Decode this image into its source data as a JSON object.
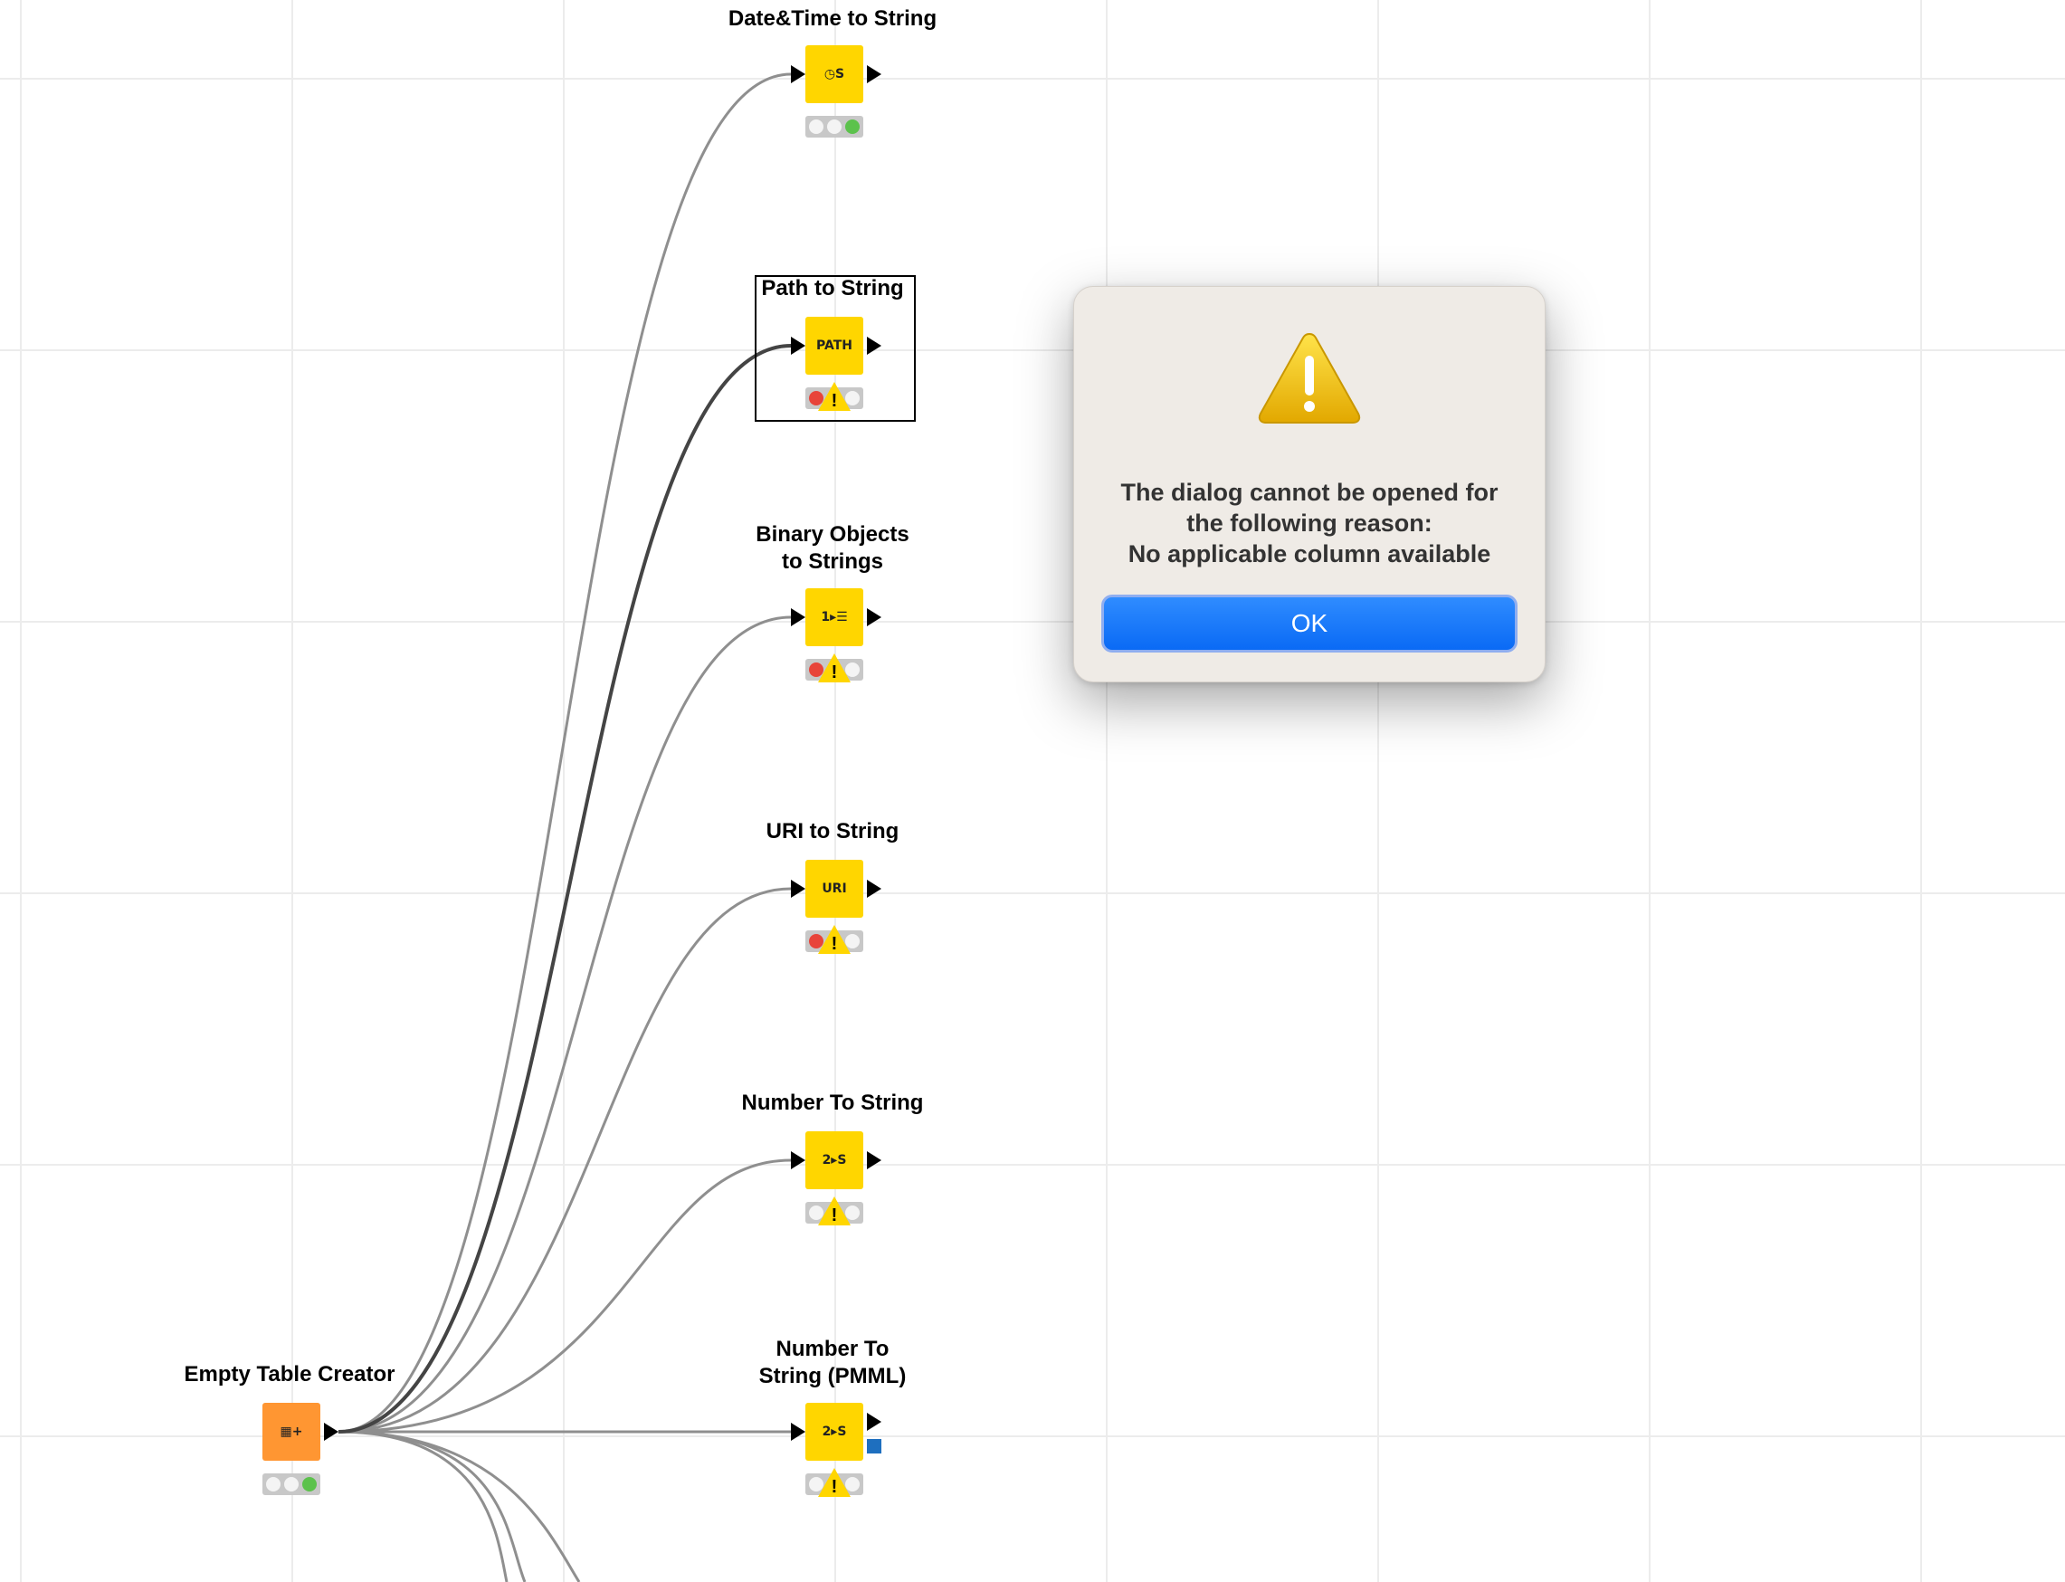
{
  "workflow": {
    "nodes": [
      {
        "id": "date_time_to_string",
        "label": "Date&Time to String",
        "icon": "clock-to-string-icon",
        "glyph": "◷S",
        "color": "yellow",
        "status": [
          "off",
          "off",
          "green"
        ],
        "warning": false
      },
      {
        "id": "path_to_string",
        "label": "Path to String",
        "icon": "path-to-string-icon",
        "glyph": "PATH",
        "color": "yellow",
        "status": [
          "red",
          "off",
          "off"
        ],
        "warning": true,
        "selected": true
      },
      {
        "id": "binary_objects_to_strings",
        "label_line1": "Binary Objects",
        "label_line2": "to Strings",
        "icon": "binary-to-string-icon",
        "glyph": "1▸☰",
        "color": "yellow",
        "status": [
          "red",
          "off",
          "off"
        ],
        "warning": true
      },
      {
        "id": "uri_to_string",
        "label": "URI to String",
        "icon": "uri-to-string-icon",
        "glyph": "URI",
        "color": "yellow",
        "status": [
          "red",
          "off",
          "off"
        ],
        "warning": true
      },
      {
        "id": "number_to_string",
        "label": "Number To String",
        "icon": "number-to-string-icon",
        "glyph": "2▸S",
        "color": "yellow",
        "status": [
          "off",
          "off",
          "off"
        ],
        "warning": true
      },
      {
        "id": "number_to_string_pmml",
        "label_line1": "Number To",
        "label_line2": "String (PMML)",
        "icon": "number-to-string-icon",
        "glyph": "2▸S",
        "color": "yellow",
        "status": [
          "off",
          "off",
          "off"
        ],
        "warning": true
      },
      {
        "id": "empty_table_creator",
        "label": "Empty Table Creator",
        "icon": "table-plus-icon",
        "glyph": "▦+",
        "color": "orange",
        "status": [
          "off",
          "off",
          "green"
        ],
        "warning": false
      }
    ],
    "warning_symbol": "!"
  },
  "dialog": {
    "icon": "warning-triangle-icon",
    "message_line1": "The dialog cannot be opened for",
    "message_line2": "the following reason:",
    "message_line3": "No applicable column available",
    "ok_label": "OK"
  },
  "colors": {
    "node_yellow": "#ffd600",
    "node_orange": "#ff9632",
    "status_red": "#e8443a",
    "status_green": "#5cc24c",
    "accent_blue": "#0a6af5",
    "dialog_bg": "#efebe6"
  }
}
